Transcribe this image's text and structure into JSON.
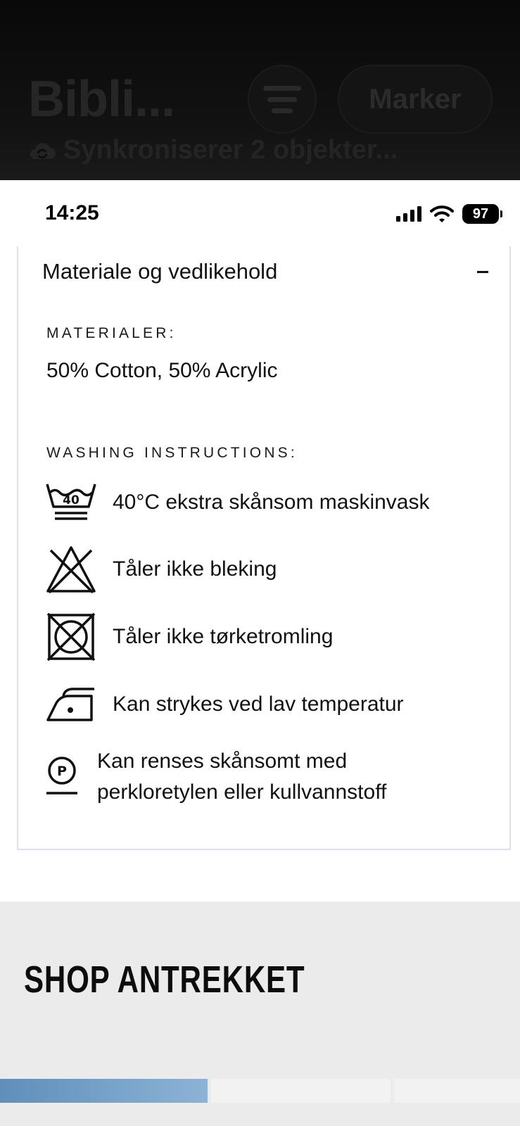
{
  "background_app": {
    "title": "Bibli...",
    "marker_label": "Marker",
    "sync_status": "Synkroniserer 2 objekter..."
  },
  "status_bar": {
    "time": "14:25",
    "battery": "97"
  },
  "accordion": {
    "header": "Materiale og vedlikehold",
    "expanded": true,
    "materials_label": "MATERIALER:",
    "materials_value": "50% Cotton, 50% Acrylic",
    "washing_label": "WASHING INSTRUCTIONS:",
    "instructions": [
      {
        "icon": "wash-40-gentle-icon",
        "symbol_text": "40",
        "text": "40°C ekstra skånsom maskinvask"
      },
      {
        "icon": "no-bleach-icon",
        "text": "Tåler ikke bleking"
      },
      {
        "icon": "no-tumble-dry-icon",
        "text": "Tåler ikke tørketromling"
      },
      {
        "icon": "iron-low-temp-icon",
        "text": "Kan strykes ved lav temperatur"
      },
      {
        "icon": "dry-clean-p-icon",
        "symbol_text": "P",
        "text_line1": "Kan renses skånsomt med",
        "text_line2": "perkloretylen eller kullvannstoff"
      }
    ]
  },
  "shop_section": {
    "title": "SHOP ANTREKKET"
  },
  "colors": {
    "panel_border": "#dde0ea",
    "shop_background": "#ebebeb",
    "thumb_blue": "#6f9bc4"
  }
}
